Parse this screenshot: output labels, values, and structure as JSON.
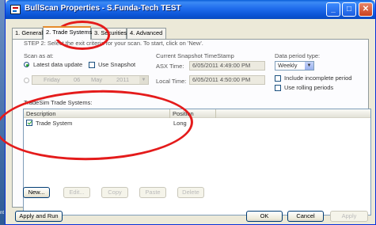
{
  "window": {
    "title": "BullScan Properties - S.Funda-Tech TEST"
  },
  "tabs": [
    {
      "label": "1. General"
    },
    {
      "label": "2. Trade Systems"
    },
    {
      "label": "3. Securities"
    },
    {
      "label": "4. Advanced"
    }
  ],
  "step_text": "STEP 2: Select the exit criteria for your scan. To start, click on 'New'.",
  "scan_as_at": {
    "label": "Scan as at:",
    "latest_label": "Latest data update",
    "snapshot_label": "Use Snapshot",
    "day": "Friday",
    "date": "06",
    "month": "May",
    "year": "2011"
  },
  "snapshot": {
    "heading": "Current Snapshot TimeStamp",
    "asx_label": "ASX Time:",
    "asx_value": "6/05/2011 4:49:00 PM",
    "local_label": "Local Time:",
    "local_value": "6/05/2011 4:50:00 PM"
  },
  "period": {
    "label": "Data period type:",
    "selected": "Weekly",
    "incomplete_label": "Include incomplete period",
    "rolling_label": "Use rolling periods"
  },
  "tradesim": {
    "label": "TradeSim Trade Systems:",
    "columns": [
      "Description",
      "Position"
    ],
    "rows": [
      {
        "description": "Trade System",
        "position": "Long"
      }
    ]
  },
  "grid_buttons": [
    "New...",
    "Edit...",
    "Copy",
    "Paste",
    "Delete"
  ],
  "footer": {
    "apply_run": "Apply and Run",
    "ok": "OK",
    "cancel": "Cancel",
    "apply": "Apply"
  },
  "bg_left_text": "nt",
  "colors": {
    "titlebar": "#1f6cec",
    "annotation": "#e41b1b",
    "active_tab_accent": "#e68b2c"
  }
}
